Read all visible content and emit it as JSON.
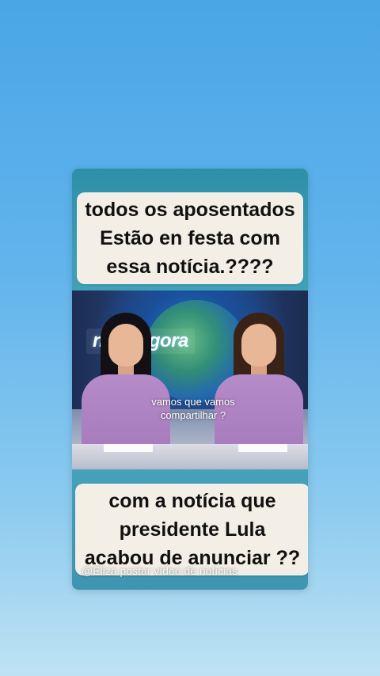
{
  "caption_top": {
    "line1": "todos os aposentados",
    "line2": "Estão en festa com",
    "line3": "essa notícia.????"
  },
  "video": {
    "channel_logo": "newsagora",
    "overlay_line1": "vamos que vamos",
    "overlay_line2": "compartilhar ?"
  },
  "caption_bottom": {
    "line1": "com a notícia que",
    "line2": "presidente Lula",
    "line3": "acabou de anunciar ??"
  },
  "watermark": "@Eliza postar vídeo de notícias",
  "colors": {
    "background_top": "#4aa6e6",
    "background_bottom": "#bfe2f3",
    "card": "#3c9fb5",
    "caption_bg": "#f3efe6",
    "blazer": "#a478bb"
  }
}
